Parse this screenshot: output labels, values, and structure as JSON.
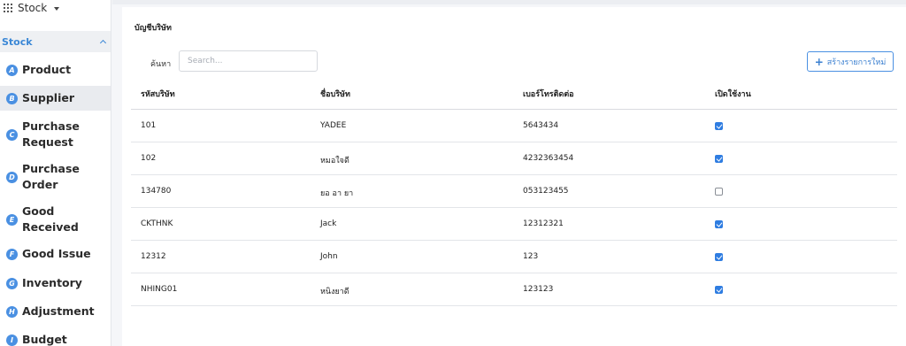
{
  "app_switcher": {
    "label": "Stock"
  },
  "sidebar": {
    "section_title": "Stock",
    "items": [
      {
        "badge": "A",
        "label": "Product",
        "active": false
      },
      {
        "badge": "B",
        "label": "Supplier",
        "active": true
      },
      {
        "badge": "C",
        "label": "Purchase Request",
        "active": false
      },
      {
        "badge": "D",
        "label": "Purchase Order",
        "active": false
      },
      {
        "badge": "E",
        "label": "Good Received",
        "active": false
      },
      {
        "badge": "F",
        "label": "Good Issue",
        "active": false
      },
      {
        "badge": "G",
        "label": "Inventory",
        "active": false
      },
      {
        "badge": "H",
        "label": "Adjustment",
        "active": false
      },
      {
        "badge": "I",
        "label": "Budget",
        "active": false
      }
    ]
  },
  "main": {
    "title": "บัญชีบริษัท",
    "search": {
      "label": "ค้นหา",
      "placeholder": "Search..."
    },
    "create_button": {
      "label": "สร้างรายการใหม่"
    },
    "table": {
      "columns": [
        "รหัสบริษัท",
        "ชื่อบริษัท",
        "เบอร์โทรติดต่อ",
        "เปิดใช้งาน"
      ],
      "rows": [
        {
          "code": "101",
          "name": "YADEE",
          "phone": "5643434",
          "enabled": true
        },
        {
          "code": "102",
          "name": "หมอใจดี",
          "phone": "4232363454",
          "enabled": true
        },
        {
          "code": "134780",
          "name": "ยอ อา ยา",
          "phone": "053123455",
          "enabled": false
        },
        {
          "code": "CKTHNK",
          "name": "Jack",
          "phone": "12312321",
          "enabled": true
        },
        {
          "code": "12312",
          "name": "John",
          "phone": "123",
          "enabled": true
        },
        {
          "code": "NHING01",
          "name": "หนิงยาดี",
          "phone": "123123",
          "enabled": true
        }
      ]
    }
  },
  "colors": {
    "accent": "#4a90e2",
    "section_text": "#3a87d6",
    "checkbox": "#2f7de1"
  }
}
